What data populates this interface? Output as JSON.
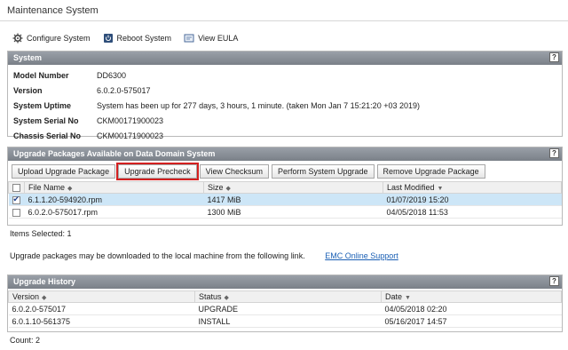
{
  "window_title": "Maintenance System",
  "toolbar": {
    "configure": "Configure System",
    "reboot": "Reboot System",
    "eula": "View EULA"
  },
  "system": {
    "title": "System",
    "help": "?",
    "rows": [
      {
        "label": "Model Number",
        "value": "DD6300"
      },
      {
        "label": "Version",
        "value": "6.0.2.0-575017"
      },
      {
        "label": "System Uptime",
        "value": "System has been up for 277 days, 3 hours, 1 minute. (taken Mon Jan 7 15:21:20 +03 2019)"
      },
      {
        "label": "System Serial No",
        "value": "CKM00171900023"
      },
      {
        "label": "Chassis Serial No",
        "value": "CKM00171900023"
      }
    ]
  },
  "upgrade": {
    "title": "Upgrade Packages Available on Data Domain System",
    "help": "?",
    "buttons": {
      "upload": "Upload Upgrade Package",
      "precheck": "Upgrade Precheck",
      "checksum": "View Checksum",
      "perform": "Perform System Upgrade",
      "remove": "Remove Upgrade Package"
    },
    "columns": {
      "file": "File Name",
      "size": "Size",
      "modified": "Last Modified"
    },
    "rows": [
      {
        "file": "6.1.1.20-594920.rpm",
        "size": "1417 MiB",
        "modified": "01/07/2019 15:20",
        "checked": true
      },
      {
        "file": "6.0.2.0-575017.rpm",
        "size": "1300 MiB",
        "modified": "04/05/2018 11:53",
        "checked": false
      }
    ],
    "items_selected": "Items Selected: 1"
  },
  "download": {
    "text": "Upgrade packages may be downloaded to the local machine from the following link.",
    "link": "EMC Online Support"
  },
  "history": {
    "title": "Upgrade History",
    "help": "?",
    "columns": {
      "version": "Version",
      "status": "Status",
      "date": "Date"
    },
    "rows": [
      {
        "version": "6.0.2.0-575017",
        "status": "UPGRADE",
        "date": "04/05/2018 02:20"
      },
      {
        "version": "6.0.1.10-561375",
        "status": "INSTALL",
        "date": "05/16/2017 14:57"
      }
    ],
    "count": "Count: 2"
  },
  "colors": {
    "highlight": "#d21f1f",
    "selected_row": "#cde6f7",
    "link": "#1a5fb4"
  }
}
